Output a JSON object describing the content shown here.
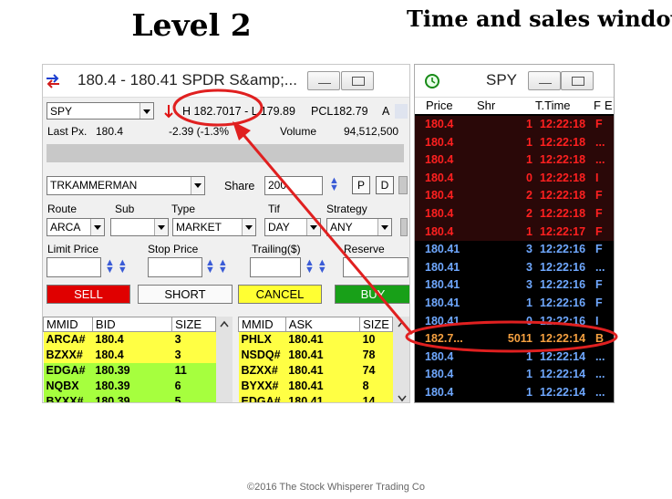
{
  "headings": {
    "left": "Level 2",
    "right": "Time and sales window"
  },
  "level2": {
    "title": "180.4 - 180.41   SPDR S&amp;...",
    "symbol": "SPY",
    "high": "H 182.7017 - L 179.89",
    "pcl": "PCL182.79",
    "a_label": "A",
    "last_px_label": "Last Px.",
    "last_px": "180.4",
    "change": "-2.39  (-1.3%",
    "volume_label": "Volume",
    "volume": "94,512,500",
    "account": "TRKAMMERMAN",
    "share_label": "Share",
    "share_value": "200",
    "p_btn": "P",
    "d_btn": "D",
    "route_label": "Route",
    "sub_label": "Sub",
    "type_label": "Type",
    "tif_label": "Tif",
    "strategy_label": "Strategy",
    "route": "ARCA",
    "sub": "",
    "type": "MARKET",
    "tif": "DAY",
    "strategy": "ANY",
    "limit_price_label": "Limit Price",
    "stop_price_label": "Stop Price",
    "trailing_label": "Trailing($)",
    "reserve_label": "Reserve",
    "buttons": {
      "sell": "SELL",
      "short": "SHORT",
      "cancel": "CANCEL",
      "buy": "BUY"
    },
    "bid_headers": [
      "MMID",
      "BID",
      "SIZE"
    ],
    "ask_headers": [
      "MMID",
      "ASK",
      "SIZE"
    ],
    "bids": [
      {
        "mmid": "ARCA#",
        "price": "180.4",
        "size": "3",
        "color": "yellow"
      },
      {
        "mmid": "BZXX#",
        "price": "180.4",
        "size": "3",
        "color": "yellow"
      },
      {
        "mmid": "EDGA#",
        "price": "180.39",
        "size": "11",
        "color": "green"
      },
      {
        "mmid": "NQBX",
        "price": "180.39",
        "size": "6",
        "color": "green"
      },
      {
        "mmid": "BYXX#",
        "price": "180.39",
        "size": "5",
        "color": "green"
      }
    ],
    "asks": [
      {
        "mmid": "PHLX",
        "price": "180.41",
        "size": "10",
        "color": "yellow"
      },
      {
        "mmid": "NSDQ#",
        "price": "180.41",
        "size": "78",
        "color": "yellow"
      },
      {
        "mmid": "BZXX#",
        "price": "180.41",
        "size": "74",
        "color": "yellow"
      },
      {
        "mmid": "BYXX#",
        "price": "180.41",
        "size": "8",
        "color": "yellow"
      },
      {
        "mmid": "EDGA#",
        "price": "180.41",
        "size": "14",
        "color": "yellow"
      }
    ]
  },
  "timesales": {
    "title": "SPY",
    "headers": [
      "Price",
      "Shr",
      "T.Time",
      "F",
      "E"
    ],
    "rows": [
      {
        "price": "180.4",
        "shr": "1",
        "time": "12:22:18",
        "flag": "F",
        "color": "red"
      },
      {
        "price": "180.4",
        "shr": "1",
        "time": "12:22:18",
        "flag": "...",
        "color": "red"
      },
      {
        "price": "180.4",
        "shr": "1",
        "time": "12:22:18",
        "flag": "...",
        "color": "red"
      },
      {
        "price": "180.4",
        "shr": "0",
        "time": "12:22:18",
        "flag": "I",
        "color": "red"
      },
      {
        "price": "180.4",
        "shr": "2",
        "time": "12:22:18",
        "flag": "F",
        "color": "red"
      },
      {
        "price": "180.4",
        "shr": "2",
        "time": "12:22:18",
        "flag": "F",
        "color": "red"
      },
      {
        "price": "180.4",
        "shr": "1",
        "time": "12:22:17",
        "flag": "F",
        "color": "red"
      },
      {
        "price": "180.41",
        "shr": "3",
        "time": "12:22:16",
        "flag": "F",
        "color": "blue"
      },
      {
        "price": "180.41",
        "shr": "3",
        "time": "12:22:16",
        "flag": "...",
        "color": "blue"
      },
      {
        "price": "180.41",
        "shr": "3",
        "time": "12:22:16",
        "flag": "F",
        "color": "blue"
      },
      {
        "price": "180.41",
        "shr": "1",
        "time": "12:22:16",
        "flag": "F",
        "color": "blue"
      },
      {
        "price": "180.41",
        "shr": "0",
        "time": "12:22:16",
        "flag": "I",
        "color": "blue"
      },
      {
        "price": "182.7...",
        "shr": "5011",
        "time": "12:22:14",
        "flag": "B",
        "color": "orange"
      },
      {
        "price": "180.4",
        "shr": "1",
        "time": "12:22:14",
        "flag": "...",
        "color": "blue"
      },
      {
        "price": "180.4",
        "shr": "1",
        "time": "12:22:14",
        "flag": "...",
        "color": "blue"
      },
      {
        "price": "180.4",
        "shr": "1",
        "time": "12:22:14",
        "flag": "...",
        "color": "blue"
      }
    ]
  },
  "footer": "©2016 The Stock Whisperer Trading Co",
  "colors": {
    "annotation": "#e02020",
    "sell": "#e00000",
    "buy": "#18a018",
    "cancel": "#ffff33"
  }
}
